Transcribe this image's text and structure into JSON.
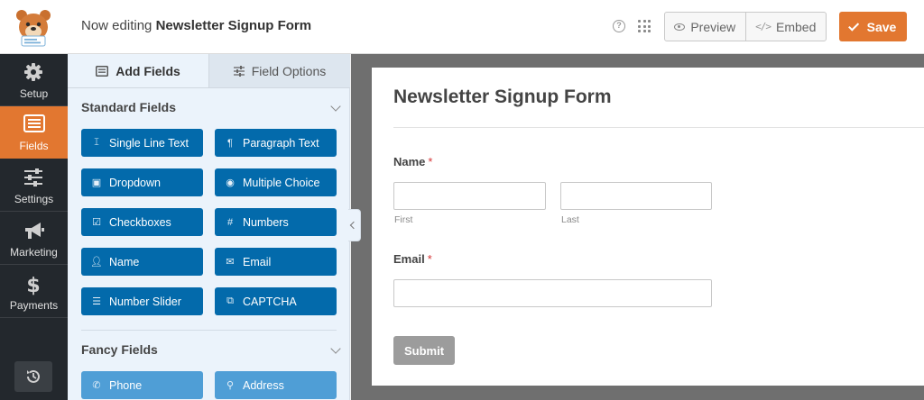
{
  "header": {
    "editing_prefix": "Now editing",
    "form_name": "Newsletter Signup Form",
    "help_icon": "help-icon",
    "grid_icon": "grid-icon",
    "preview_label": "Preview",
    "embed_label": "Embed",
    "save_label": "Save"
  },
  "nav": {
    "items": [
      {
        "label": "Setup",
        "icon": "gear-icon"
      },
      {
        "label": "Fields",
        "icon": "fields-icon"
      },
      {
        "label": "Settings",
        "icon": "sliders-icon"
      },
      {
        "label": "Marketing",
        "icon": "megaphone-icon"
      },
      {
        "label": "Payments",
        "icon": "dollar-icon"
      }
    ],
    "undo_icon": "history-icon"
  },
  "panel": {
    "tabs": [
      {
        "label": "Add Fields",
        "icon": "list-icon",
        "active": true
      },
      {
        "label": "Field Options",
        "icon": "sliders-icon",
        "active": false
      }
    ],
    "standard_title": "Standard Fields",
    "standard_fields": [
      {
        "label": "Single Line Text",
        "icon": "text-cursor-icon"
      },
      {
        "label": "Paragraph Text",
        "icon": "paragraph-icon"
      },
      {
        "label": "Dropdown",
        "icon": "dropdown-icon"
      },
      {
        "label": "Multiple Choice",
        "icon": "radio-icon"
      },
      {
        "label": "Checkboxes",
        "icon": "checkbox-icon"
      },
      {
        "label": "Numbers",
        "icon": "hash-icon"
      },
      {
        "label": "Name",
        "icon": "user-icon"
      },
      {
        "label": "Email",
        "icon": "envelope-icon"
      },
      {
        "label": "Number Slider",
        "icon": "sliders-icon"
      },
      {
        "label": "CAPTCHA",
        "icon": "captcha-icon"
      }
    ],
    "fancy_title": "Fancy Fields",
    "fancy_fields": [
      {
        "label": "Phone",
        "icon": "phone-icon"
      },
      {
        "label": "Address",
        "icon": "map-pin-icon"
      }
    ]
  },
  "form": {
    "title": "Newsletter Signup Form",
    "name_label": "Name",
    "required_mark": "*",
    "first_sublabel": "First",
    "last_sublabel": "Last",
    "email_label": "Email",
    "submit_label": "Submit"
  },
  "colors": {
    "accent": "#e27730",
    "field_button": "#036aab",
    "field_button_light": "#4f9ed6",
    "nav_bg": "#23282d"
  }
}
